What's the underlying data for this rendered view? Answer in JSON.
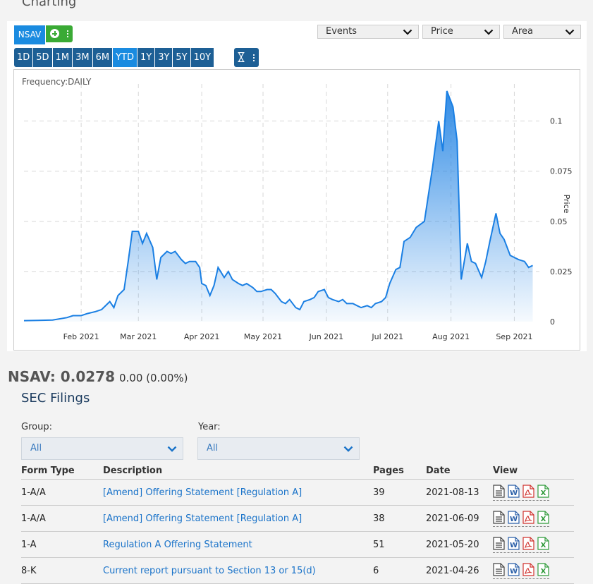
{
  "section_title": "Charting",
  "toolbar": {
    "symbol": "NSAV",
    "ranges": [
      "1D",
      "5D",
      "1M",
      "3M",
      "6M",
      "YTD",
      "1Y",
      "3Y",
      "5Y",
      "10Y"
    ],
    "active_range": "YTD",
    "selects": {
      "events": "Events",
      "price": "Price",
      "type": "Area"
    },
    "accent": "#1a8be0",
    "range_bg": "#1d5f95",
    "add_color": "#3aaa35"
  },
  "chart_data": {
    "type": "area",
    "frequency_label": "Frequency:DAILY",
    "ylabel": "Price",
    "y_ticks": [
      0,
      0.025,
      0.05,
      0.075,
      0.1
    ],
    "y_tick_labels": [
      "0",
      "0.025",
      "0.05",
      "0.075",
      "0.1"
    ],
    "ylim": [
      0,
      0.115
    ],
    "x_tick_labels": [
      {
        "date": "2021-02-01",
        "label": "Feb 2021"
      },
      {
        "date": "2021-03-01",
        "label": "Mar 2021"
      },
      {
        "date": "2021-04-01",
        "label": "Apr 2021"
      },
      {
        "date": "2021-05-01",
        "label": "May 2021"
      },
      {
        "date": "2021-06-01",
        "label": "Jun 2021"
      },
      {
        "date": "2021-07-01",
        "label": "Jul 2021"
      },
      {
        "date": "2021-08-01",
        "label": "Aug 2021"
      },
      {
        "date": "2021-09-01",
        "label": "Sep 2021"
      }
    ],
    "xlim": [
      "2021-01-04",
      "2021-09-15"
    ],
    "series": [
      {
        "points": [
          [
            "2021-01-04",
            0.0005
          ],
          [
            "2021-01-11",
            0.0006
          ],
          [
            "2021-01-18",
            0.0008
          ],
          [
            "2021-01-25",
            0.002
          ],
          [
            "2021-01-28",
            0.003
          ],
          [
            "2021-02-01",
            0.003
          ],
          [
            "2021-02-04",
            0.004
          ],
          [
            "2021-02-08",
            0.005
          ],
          [
            "2021-02-11",
            0.006
          ],
          [
            "2021-02-15",
            0.01
          ],
          [
            "2021-02-17",
            0.007
          ],
          [
            "2021-02-19",
            0.013
          ],
          [
            "2021-02-22",
            0.016
          ],
          [
            "2021-02-24",
            0.03
          ],
          [
            "2021-02-26",
            0.045
          ],
          [
            "2021-03-01",
            0.045
          ],
          [
            "2021-03-03",
            0.039
          ],
          [
            "2021-03-05",
            0.044
          ],
          [
            "2021-03-08",
            0.037
          ],
          [
            "2021-03-10",
            0.021
          ],
          [
            "2021-03-12",
            0.032
          ],
          [
            "2021-03-15",
            0.035
          ],
          [
            "2021-03-17",
            0.034
          ],
          [
            "2021-03-19",
            0.035
          ],
          [
            "2021-03-22",
            0.031
          ],
          [
            "2021-03-24",
            0.029
          ],
          [
            "2021-03-26",
            0.03
          ],
          [
            "2021-03-29",
            0.03
          ],
          [
            "2021-03-31",
            0.027
          ],
          [
            "2021-04-01",
            0.019
          ],
          [
            "2021-04-03",
            0.018
          ],
          [
            "2021-04-05",
            0.013
          ],
          [
            "2021-04-07",
            0.018
          ],
          [
            "2021-04-09",
            0.027
          ],
          [
            "2021-04-12",
            0.022
          ],
          [
            "2021-04-14",
            0.025
          ],
          [
            "2021-04-16",
            0.021
          ],
          [
            "2021-04-19",
            0.019
          ],
          [
            "2021-04-21",
            0.018
          ],
          [
            "2021-04-23",
            0.019
          ],
          [
            "2021-04-26",
            0.017
          ],
          [
            "2021-04-28",
            0.015
          ],
          [
            "2021-04-30",
            0.015
          ],
          [
            "2021-05-03",
            0.016
          ],
          [
            "2021-05-05",
            0.016
          ],
          [
            "2021-05-07",
            0.014
          ],
          [
            "2021-05-10",
            0.01
          ],
          [
            "2021-05-12",
            0.009
          ],
          [
            "2021-05-14",
            0.011
          ],
          [
            "2021-05-17",
            0.007
          ],
          [
            "2021-05-19",
            0.006
          ],
          [
            "2021-05-21",
            0.01
          ],
          [
            "2021-05-24",
            0.011
          ],
          [
            "2021-05-26",
            0.012
          ],
          [
            "2021-05-28",
            0.015
          ],
          [
            "2021-05-31",
            0.016
          ],
          [
            "2021-06-02",
            0.012
          ],
          [
            "2021-06-04",
            0.011
          ],
          [
            "2021-06-07",
            0.01
          ],
          [
            "2021-06-09",
            0.011
          ],
          [
            "2021-06-11",
            0.009
          ],
          [
            "2021-06-14",
            0.009
          ],
          [
            "2021-06-16",
            0.008
          ],
          [
            "2021-06-18",
            0.007
          ],
          [
            "2021-06-21",
            0.008
          ],
          [
            "2021-06-23",
            0.007
          ],
          [
            "2021-06-25",
            0.009
          ],
          [
            "2021-06-28",
            0.01
          ],
          [
            "2021-06-30",
            0.012
          ],
          [
            "2021-07-02",
            0.019
          ],
          [
            "2021-07-05",
            0.026
          ],
          [
            "2021-07-07",
            0.027
          ],
          [
            "2021-07-09",
            0.04
          ],
          [
            "2021-07-12",
            0.042
          ],
          [
            "2021-07-15",
            0.047
          ],
          [
            "2021-07-19",
            0.05
          ],
          [
            "2021-07-23",
            0.077
          ],
          [
            "2021-07-26",
            0.1
          ],
          [
            "2021-07-28",
            0.085
          ],
          [
            "2021-07-30",
            0.115
          ],
          [
            "2021-08-02",
            0.107
          ],
          [
            "2021-08-04",
            0.09
          ],
          [
            "2021-08-06",
            0.021
          ],
          [
            "2021-08-09",
            0.039
          ],
          [
            "2021-08-11",
            0.03
          ],
          [
            "2021-08-13",
            0.029
          ],
          [
            "2021-08-16",
            0.022
          ],
          [
            "2021-08-18",
            0.03
          ],
          [
            "2021-08-20",
            0.04
          ],
          [
            "2021-08-23",
            0.054
          ],
          [
            "2021-08-25",
            0.044
          ],
          [
            "2021-08-27",
            0.041
          ],
          [
            "2021-08-30",
            0.033
          ],
          [
            "2021-09-01",
            0.032
          ],
          [
            "2021-09-03",
            0.031
          ],
          [
            "2021-09-06",
            0.03
          ],
          [
            "2021-09-08",
            0.027
          ],
          [
            "2021-09-10",
            0.028
          ]
        ]
      }
    ],
    "line_color": "#1a7fe3",
    "grid": true
  },
  "quote": {
    "text": "NSAV: 0.0278",
    "change": "0.00 (0.00%)"
  },
  "sec": {
    "title": "SEC Filings",
    "group_label": "Group:",
    "group_value": "All",
    "year_label": "Year:",
    "year_value": "All",
    "columns": [
      "Form Type",
      "Description",
      "Pages",
      "Date",
      "View"
    ],
    "rows": [
      {
        "form": "1-A/A",
        "desc": "[Amend] Offering Statement [Regulation A]",
        "pages": "39",
        "date": "2021-08-13"
      },
      {
        "form": "1-A/A",
        "desc": "[Amend] Offering Statement [Regulation A]",
        "pages": "38",
        "date": "2021-06-09"
      },
      {
        "form": "1-A",
        "desc": "Regulation A Offering Statement",
        "pages": "51",
        "date": "2021-05-20"
      },
      {
        "form": "8-K",
        "desc": "Current report pursuant to Section 13 or 15(d)",
        "pages": "6",
        "date": "2021-04-26"
      }
    ],
    "view_icons": [
      "html-doc-icon",
      "word-doc-icon",
      "pdf-doc-icon",
      "excel-doc-icon"
    ]
  }
}
